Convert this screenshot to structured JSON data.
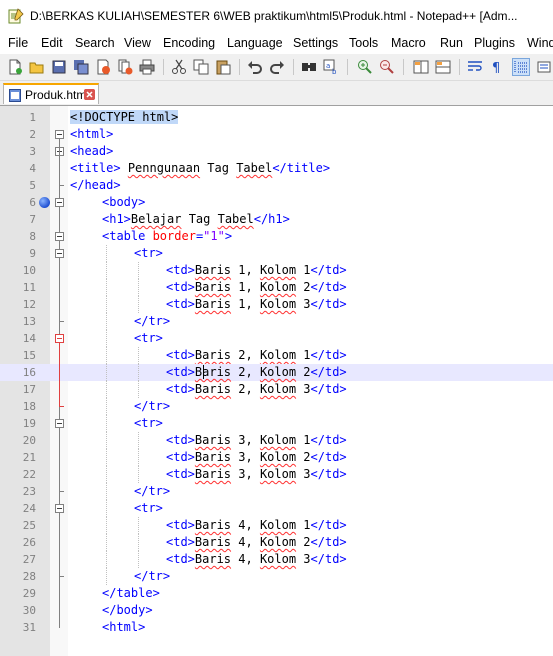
{
  "window": {
    "title": "D:\\BERKAS KULIAH\\SEMESTER 6\\WEB praktikum\\html5\\Produk.html - Notepad++ [Adm..."
  },
  "menu": [
    "File",
    "Edit",
    "Search",
    "View",
    "Encoding",
    "Language",
    "Settings",
    "Tools",
    "Macro",
    "Run",
    "Plugins",
    "Windo"
  ],
  "toolbar": {
    "icons": [
      "new-file-icon",
      "open-file-icon",
      "save-icon",
      "save-all-icon",
      "close-icon",
      "close-all-icon",
      "print-icon",
      "cut-icon",
      "copy-icon",
      "paste-icon",
      "undo-icon",
      "redo-icon",
      "find-icon",
      "replace-icon",
      "zoom-in-icon",
      "zoom-out-icon",
      "sync-vertical-icon",
      "sync-horizontal-icon",
      "word-wrap-icon",
      "show-all-chars-icon",
      "indent-guide-icon"
    ]
  },
  "tab": {
    "label": "Produk.html"
  },
  "colors": {
    "tag": "#0000ff",
    "attr": "#ff0000",
    "string": "#8000ff",
    "current_line": "#e8e8ff",
    "tab_accent": "#f7a600"
  },
  "editor": {
    "current_line": 16,
    "lines": [
      {
        "n": "1",
        "indent": 0,
        "parts": [
          [
            "doc",
            "<!DOCTYPE html>"
          ]
        ]
      },
      {
        "n": "2",
        "indent": 0,
        "parts": [
          [
            "tag",
            "<html>"
          ]
        ]
      },
      {
        "n": "3",
        "indent": 0,
        "parts": [
          [
            "tag",
            "<head>"
          ]
        ]
      },
      {
        "n": "4",
        "indent": 0,
        "parts": [
          [
            "tag",
            "<title>"
          ],
          [
            "plain",
            " "
          ],
          [
            "text",
            "Penngunaan"
          ],
          [
            "plain",
            " Tag "
          ],
          [
            "text",
            "Tabel"
          ],
          [
            "tag",
            "</title>"
          ]
        ]
      },
      {
        "n": "5",
        "indent": 0,
        "parts": [
          [
            "tag",
            "</head>"
          ]
        ]
      },
      {
        "n": "6",
        "indent": 1,
        "parts": [
          [
            "tag",
            "<body>"
          ]
        ]
      },
      {
        "n": "7",
        "indent": 1,
        "parts": [
          [
            "tag",
            "<h1>"
          ],
          [
            "text",
            "Belajar"
          ],
          [
            "plain",
            " Tag "
          ],
          [
            "text",
            "Tabel"
          ],
          [
            "tag",
            "</h1>"
          ]
        ]
      },
      {
        "n": "8",
        "indent": 1,
        "parts": [
          [
            "tag",
            "<table "
          ],
          [
            "attr",
            "border"
          ],
          [
            "tag",
            "="
          ],
          [
            "str",
            "\"1\""
          ],
          [
            "tag",
            ">"
          ]
        ]
      },
      {
        "n": "9",
        "indent": 2,
        "parts": [
          [
            "tag",
            "<tr>"
          ]
        ]
      },
      {
        "n": "10",
        "indent": 3,
        "parts": [
          [
            "tag",
            "<td>"
          ],
          [
            "text",
            "Baris"
          ],
          [
            "plain",
            " 1, "
          ],
          [
            "text",
            "Kolom"
          ],
          [
            "plain",
            " 1"
          ],
          [
            "tag",
            "</td>"
          ]
        ]
      },
      {
        "n": "11",
        "indent": 3,
        "parts": [
          [
            "tag",
            "<td>"
          ],
          [
            "text",
            "Baris"
          ],
          [
            "plain",
            " 1, "
          ],
          [
            "text",
            "Kolom"
          ],
          [
            "plain",
            " 2"
          ],
          [
            "tag",
            "</td>"
          ]
        ]
      },
      {
        "n": "12",
        "indent": 3,
        "parts": [
          [
            "tag",
            "<td>"
          ],
          [
            "text",
            "Baris"
          ],
          [
            "plain",
            " 1, "
          ],
          [
            "text",
            "Kolom"
          ],
          [
            "plain",
            " 3"
          ],
          [
            "tag",
            "</td>"
          ]
        ]
      },
      {
        "n": "13",
        "indent": 2,
        "parts": [
          [
            "tag",
            "</tr>"
          ]
        ]
      },
      {
        "n": "14",
        "indent": 2,
        "parts": [
          [
            "tag",
            "<tr>"
          ]
        ]
      },
      {
        "n": "15",
        "indent": 3,
        "parts": [
          [
            "tag",
            "<td>"
          ],
          [
            "text",
            "Baris"
          ],
          [
            "plain",
            " 2, "
          ],
          [
            "text",
            "Kolom"
          ],
          [
            "plain",
            " 1"
          ],
          [
            "tag",
            "</td>"
          ]
        ]
      },
      {
        "n": "16",
        "indent": 3,
        "parts": [
          [
            "tag",
            "<td>"
          ],
          [
            "text",
            "Baris"
          ],
          [
            "plain",
            " 2, "
          ],
          [
            "text",
            "Kolom"
          ],
          [
            "plain",
            " 2"
          ],
          [
            "tag",
            "</td>"
          ]
        ]
      },
      {
        "n": "17",
        "indent": 3,
        "parts": [
          [
            "tag",
            "<td>"
          ],
          [
            "text",
            "Baris"
          ],
          [
            "plain",
            " 2, "
          ],
          [
            "text",
            "Kolom"
          ],
          [
            "plain",
            " 3"
          ],
          [
            "tag",
            "</td>"
          ]
        ]
      },
      {
        "n": "18",
        "indent": 2,
        "parts": [
          [
            "tag",
            "</tr>"
          ]
        ]
      },
      {
        "n": "19",
        "indent": 2,
        "parts": [
          [
            "tag",
            "<tr>"
          ]
        ]
      },
      {
        "n": "20",
        "indent": 3,
        "parts": [
          [
            "tag",
            "<td>"
          ],
          [
            "text",
            "Baris"
          ],
          [
            "plain",
            " 3, "
          ],
          [
            "text",
            "Kolom"
          ],
          [
            "plain",
            " 1"
          ],
          [
            "tag",
            "</td>"
          ]
        ]
      },
      {
        "n": "21",
        "indent": 3,
        "parts": [
          [
            "tag",
            "<td>"
          ],
          [
            "text",
            "Baris"
          ],
          [
            "plain",
            " 3, "
          ],
          [
            "text",
            "Kolom"
          ],
          [
            "plain",
            " 2"
          ],
          [
            "tag",
            "</td>"
          ]
        ]
      },
      {
        "n": "22",
        "indent": 3,
        "parts": [
          [
            "tag",
            "<td>"
          ],
          [
            "text",
            "Baris"
          ],
          [
            "plain",
            " 3, "
          ],
          [
            "text",
            "Kolom"
          ],
          [
            "plain",
            " 3"
          ],
          [
            "tag",
            "</td>"
          ]
        ]
      },
      {
        "n": "23",
        "indent": 2,
        "parts": [
          [
            "tag",
            "</tr>"
          ]
        ]
      },
      {
        "n": "24",
        "indent": 2,
        "parts": [
          [
            "tag",
            "<tr>"
          ]
        ]
      },
      {
        "n": "25",
        "indent": 3,
        "parts": [
          [
            "tag",
            "<td>"
          ],
          [
            "text",
            "Baris"
          ],
          [
            "plain",
            " 4, "
          ],
          [
            "text",
            "Kolom"
          ],
          [
            "plain",
            " 1"
          ],
          [
            "tag",
            "</td>"
          ]
        ]
      },
      {
        "n": "26",
        "indent": 3,
        "parts": [
          [
            "tag",
            "<td>"
          ],
          [
            "text",
            "Baris"
          ],
          [
            "plain",
            " 4, "
          ],
          [
            "text",
            "Kolom"
          ],
          [
            "plain",
            " 2"
          ],
          [
            "tag",
            "</td>"
          ]
        ]
      },
      {
        "n": "27",
        "indent": 3,
        "parts": [
          [
            "tag",
            "<td>"
          ],
          [
            "text",
            "Baris"
          ],
          [
            "plain",
            " 4, "
          ],
          [
            "text",
            "Kolom"
          ],
          [
            "plain",
            " 3"
          ],
          [
            "tag",
            "</td>"
          ]
        ]
      },
      {
        "n": "28",
        "indent": 2,
        "parts": [
          [
            "tag",
            "</tr>"
          ]
        ]
      },
      {
        "n": "29",
        "indent": 1,
        "parts": [
          [
            "tag",
            "</table>"
          ]
        ]
      },
      {
        "n": "30",
        "indent": 1,
        "parts": [
          [
            "tag",
            "</body>"
          ]
        ]
      },
      {
        "n": "31",
        "indent": 1,
        "parts": [
          [
            "tag",
            "<html>"
          ]
        ]
      }
    ]
  }
}
